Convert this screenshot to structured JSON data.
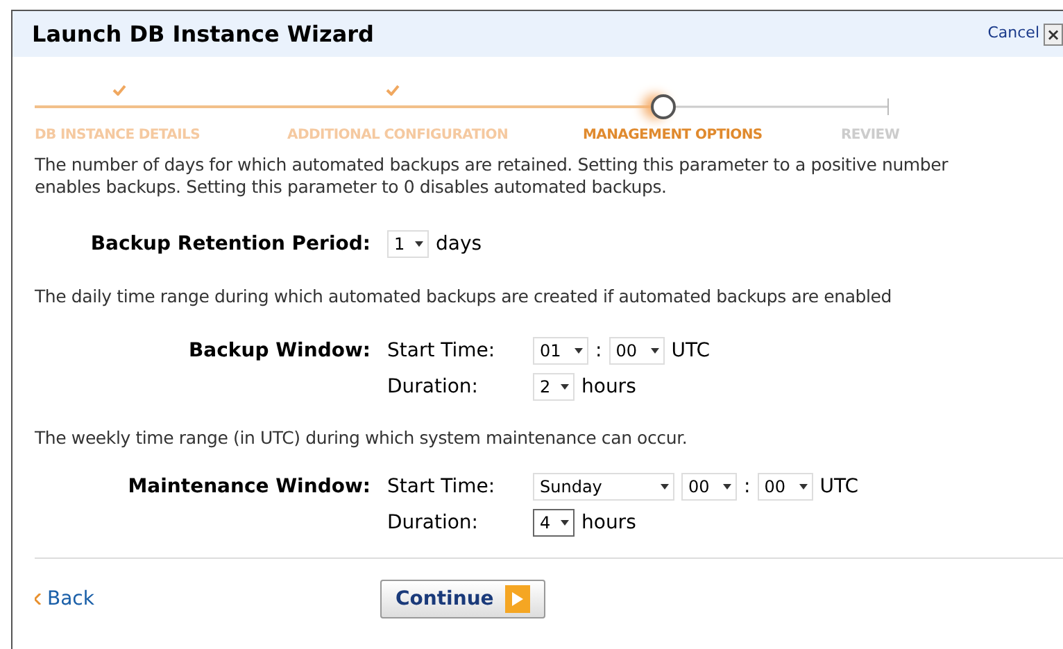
{
  "window": {
    "title": "Launch DB Instance Wizard",
    "cancel": "Cancel",
    "close": "×"
  },
  "steps": [
    {
      "label": "DB INSTANCE DETAILS",
      "kind": "done"
    },
    {
      "label": "ADDITIONAL CONFIGURATION",
      "kind": "done"
    },
    {
      "label": "MANAGEMENT OPTIONS",
      "kind": "current"
    },
    {
      "label": "REVIEW",
      "kind": "pending"
    }
  ],
  "retention": {
    "description": "The number of days for which automated backups are retained. Setting this parameter to a positive number enables backups. Setting this parameter to 0 disables automated backups.",
    "label": "Backup Retention Period:",
    "value": "1",
    "unit": "days"
  },
  "backup_window": {
    "description": "The daily time range during which automated backups are created if automated backups are enabled",
    "label": "Backup Window:",
    "start_label": "Start Time:",
    "hour": "01",
    "separator": ":",
    "minute": "00",
    "timezone": "UTC",
    "duration_label": "Duration:",
    "duration": "2",
    "duration_unit": "hours",
    "duration_focused": false
  },
  "maintenance_window": {
    "description": "The weekly time range (in UTC) during which system maintenance can occur.",
    "label": "Maintenance Window:",
    "start_label": "Start Time:",
    "day": "Sunday",
    "hour": "00",
    "separator": ":",
    "minute": "00",
    "timezone": "UTC",
    "duration_label": "Duration:",
    "duration": "4",
    "duration_unit": "hours",
    "duration_focused": true
  },
  "footer": {
    "back": "Back",
    "continue": "Continue"
  }
}
